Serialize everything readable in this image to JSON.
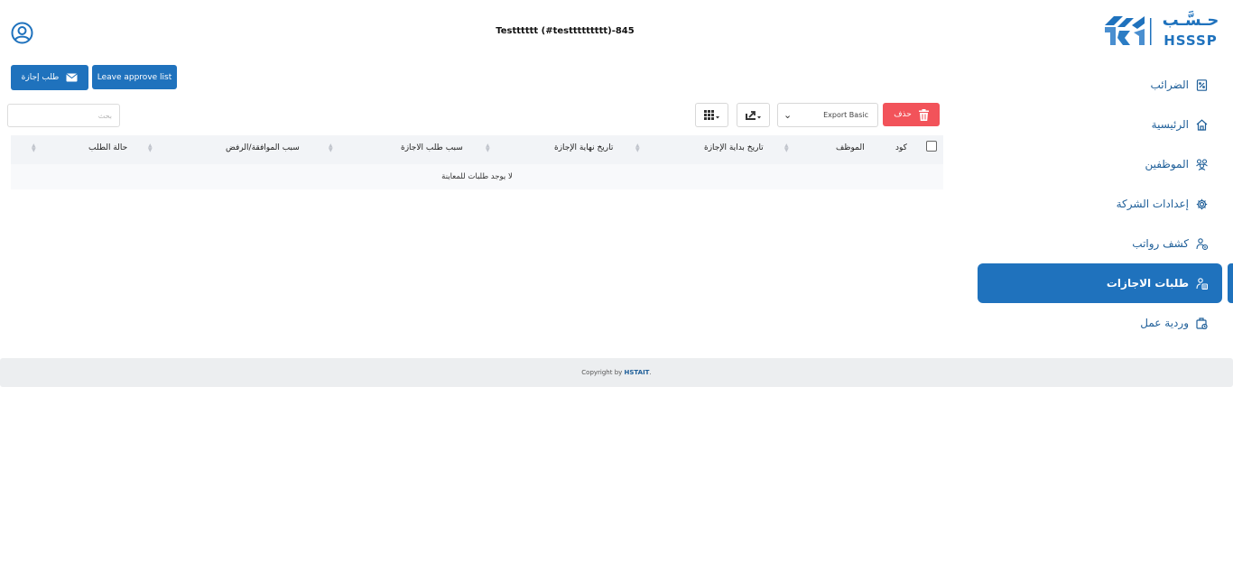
{
  "header": {
    "title": "Testttttt (#testtttttttt)-845",
    "user_icon": "user-circle-icon"
  },
  "logo": {
    "arabic": "حـسَّـب",
    "latin": "HSSSP",
    "icon": "hsssp-logo-icon"
  },
  "actions": {
    "leave_request_label": "طلب إجازة",
    "leave_request_icon": "envelope-icon",
    "leave_approve_label": "Leave approve list"
  },
  "toolbar": {
    "delete_label": "حذف",
    "delete_icon": "trash-icon",
    "export_value": "Export Basic",
    "export_icon": "export-icon",
    "columns_icon": "grid-icon",
    "search_placeholder": "بحث"
  },
  "table": {
    "columns": [
      "كود",
      "الموظف",
      "تاريخ بداية الإجازة",
      "تاريخ نهاية الإجازة",
      "سبب طلب الاجازة",
      "سبب الموافقة/الرفض",
      "حالة الطلب"
    ],
    "empty_message": "لا يوجد طلبات للمعاينة"
  },
  "sidebar": {
    "items": [
      {
        "label": "الضرائب",
        "icon": "receipt-icon"
      },
      {
        "label": "الرئيسية",
        "icon": "home-icon"
      },
      {
        "label": "الموظفين",
        "icon": "users-icon"
      },
      {
        "label": "إعدادات الشركة",
        "icon": "gear-icon"
      },
      {
        "label": "كشف رواتب",
        "icon": "payroll-icon"
      },
      {
        "label": "طلبات الاجازات",
        "icon": "leave-requests-icon",
        "active": true
      },
      {
        "label": "وردية عمل",
        "icon": "shift-icon"
      }
    ]
  },
  "footer": {
    "prefix": "Copyright by ",
    "brand": "HSTAIT",
    "suffix": "."
  },
  "colors": {
    "primary": "#1f72bd",
    "danger": "#f2535a",
    "nav_text": "#1f5f99"
  }
}
